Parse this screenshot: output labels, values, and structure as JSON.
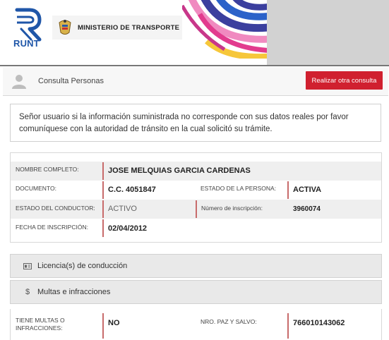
{
  "header": {
    "runt_label": "RUNT",
    "ministry_label": "MINISTERIO DE TRANSPORTE",
    "colors": {
      "runt_blue": "#1f56a8",
      "accent_red": "#d0202f"
    }
  },
  "topbar": {
    "title": "Consulta Personas",
    "button_label": "Realizar otra consulta"
  },
  "notice": {
    "line1": "Señor usuario si la información suministrada no corresponde con sus datos reales por favor",
    "line2": "comuníquese con la autoridad de tránsito en la cual solicitó su trámite."
  },
  "person": {
    "nombre_label": "NOMBRE COMPLETO:",
    "nombre_value": "JOSE MELQUIAS GARCIA CARDENAS",
    "documento_label": "DOCUMENTO:",
    "documento_value": "C.C. 4051847",
    "estado_persona_label": "ESTADO DE LA PERSONA:",
    "estado_persona_value": "ACTIVA",
    "estado_conductor_label": "ESTADO DEL CONDUCTOR:",
    "estado_conductor_value": "ACTIVO",
    "inscripcion_label": "Número de inscripción:",
    "inscripcion_value": "3960074",
    "fecha_label": "FECHA DE INSCRIPCIÓN:",
    "fecha_value": "02/04/2012"
  },
  "sections": {
    "licencias_label": "Licencia(s) de conducción",
    "licencias_icon": "license-card-icon",
    "multas_label": "Multas e infracciones",
    "multas_icon": "dollar-icon",
    "multas_icon_glyph": "$"
  },
  "multas": {
    "tiene_label_1": "TIENE MULTAS O",
    "tiene_label_2": "INFRACCIONES:",
    "tiene_value": "NO",
    "paz_label": "NRO. PAZ Y SALVO:",
    "paz_value": "766010143062"
  }
}
